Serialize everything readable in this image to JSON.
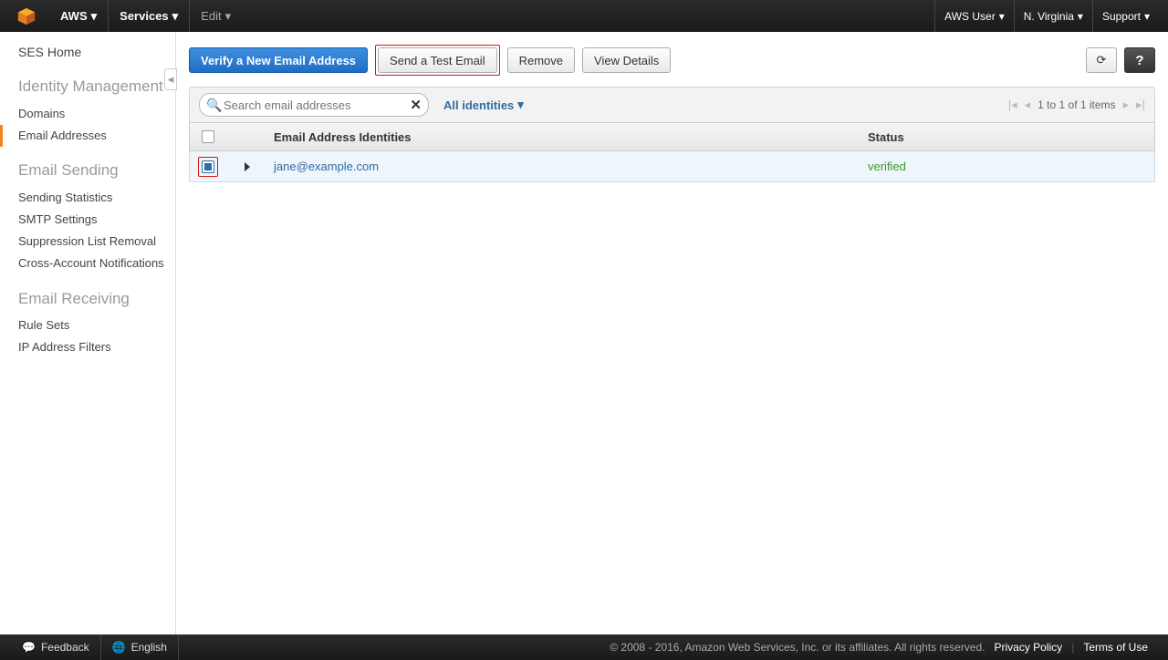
{
  "topnav": {
    "brand": "AWS",
    "services": "Services",
    "edit": "Edit",
    "user": "AWS User",
    "region": "N. Virginia",
    "support": "Support"
  },
  "sidebar": {
    "home": "SES Home",
    "sections": [
      {
        "title": "Identity Management",
        "items": [
          "Domains",
          "Email Addresses"
        ],
        "active_index": 1
      },
      {
        "title": "Email Sending",
        "items": [
          "Sending Statistics",
          "SMTP Settings",
          "Suppression List Removal",
          "Cross-Account Notifications"
        ]
      },
      {
        "title": "Email Receiving",
        "items": [
          "Rule Sets",
          "IP Address Filters"
        ]
      }
    ]
  },
  "toolbar": {
    "verify": "Verify a New Email Address",
    "send_test": "Send a Test Email",
    "remove": "Remove",
    "view_details": "View Details",
    "help_glyph": "?"
  },
  "filterbar": {
    "search_placeholder": "Search email addresses",
    "filter_label": "All identities",
    "pager_text": "1 to 1 of 1 items"
  },
  "table": {
    "headers": {
      "identity": "Email Address Identities",
      "status": "Status"
    },
    "rows": [
      {
        "email": "jane@example.com",
        "status": "verified",
        "checked": true
      }
    ]
  },
  "footer": {
    "feedback": "Feedback",
    "language": "English",
    "copyright": "© 2008 - 2016, Amazon Web Services, Inc. or its affiliates. All rights reserved.",
    "privacy": "Privacy Policy",
    "terms": "Terms of Use"
  }
}
